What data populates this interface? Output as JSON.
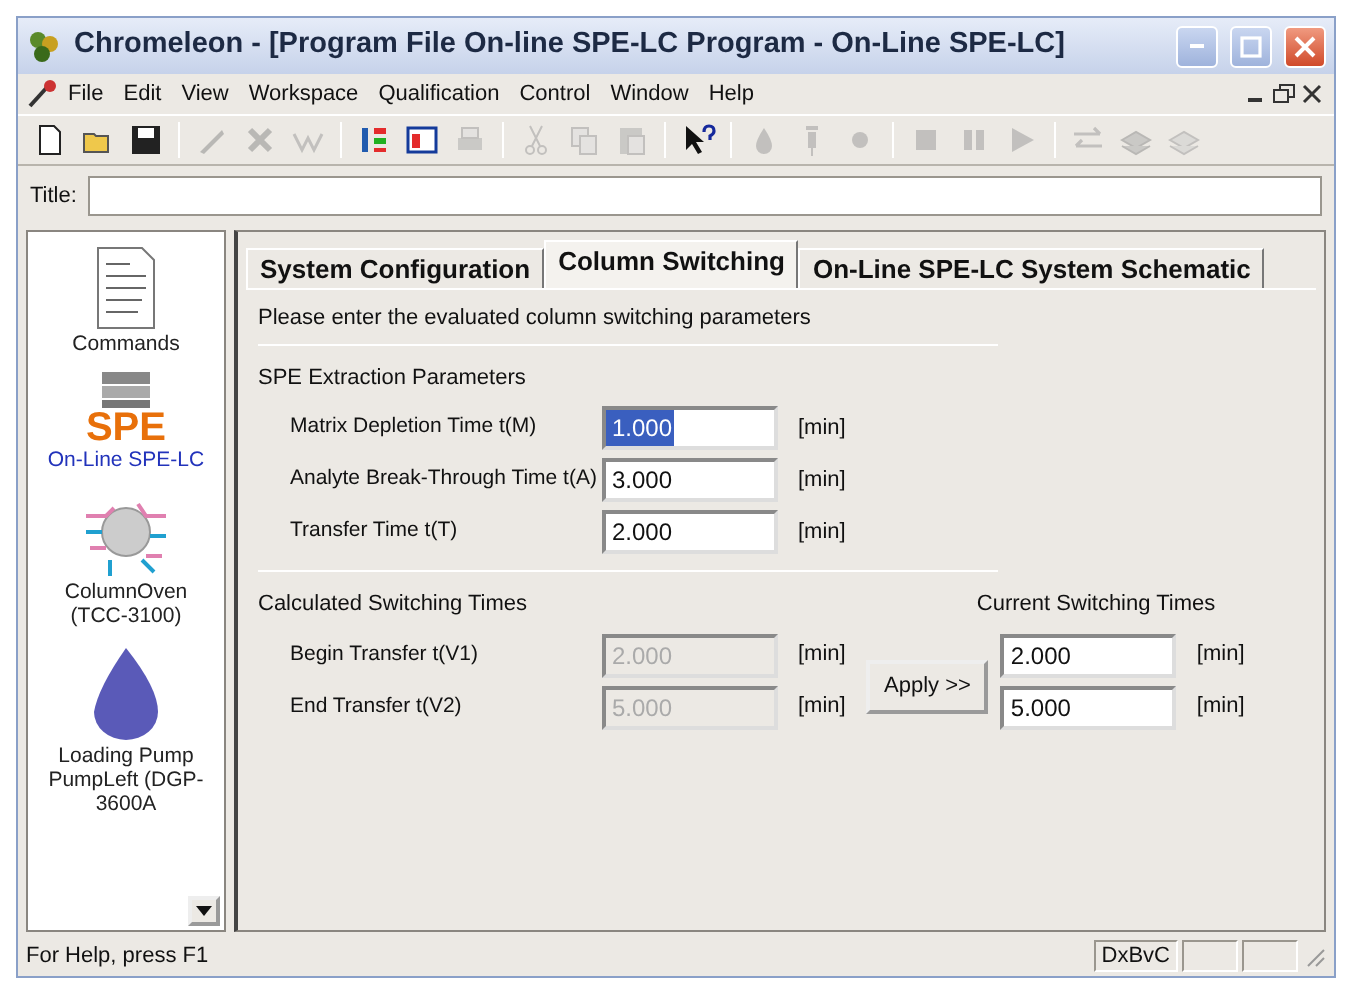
{
  "window": {
    "title": "Chromeleon - [Program File On-line SPE-LC Program - On-Line SPE-LC]"
  },
  "menu": [
    "File",
    "Edit",
    "View",
    "Workspace",
    "Qualification",
    "Control",
    "Window",
    "Help"
  ],
  "toolbar": [
    [
      {
        "disabled": false
      },
      {
        "disabled": false
      },
      {
        "disabled": false
      }
    ],
    [
      {
        "disabled": true
      },
      {
        "disabled": true
      },
      {
        "disabled": true
      }
    ],
    [
      {
        "disabled": false
      },
      {
        "disabled": false
      },
      {
        "disabled": true
      }
    ],
    [
      {
        "disabled": true
      },
      {
        "disabled": true
      },
      {
        "disabled": true
      }
    ],
    [
      {
        "disabled": false
      }
    ],
    [
      {
        "disabled": true
      },
      {
        "disabled": true
      },
      {
        "disabled": true
      }
    ],
    [
      {
        "disabled": true
      },
      {
        "disabled": true
      },
      {
        "disabled": true
      }
    ],
    [
      {
        "disabled": true
      },
      {
        "disabled": true
      },
      {
        "disabled": true
      }
    ]
  ],
  "title_field": {
    "label": "Title:"
  },
  "sidebar": {
    "items": [
      {
        "kind": "commands",
        "label": "Commands",
        "selected": false
      },
      {
        "kind": "spe",
        "label": "On-Line SPE-LC",
        "selected": true,
        "badge": "SPE"
      },
      {
        "kind": "oven",
        "label": "ColumnOven (TCC-3100)",
        "selected": false
      },
      {
        "kind": "pump",
        "label": "Loading Pump PumpLeft (DGP-3600A",
        "selected": false
      }
    ]
  },
  "tabs": [
    {
      "label": "System Configuration",
      "selected": false
    },
    {
      "label": "Column Switching",
      "selected": true
    },
    {
      "label": "On-Line SPE-LC System Schematic",
      "selected": false
    }
  ],
  "instruction": "Please enter the evaluated column switching parameters",
  "spe_section": {
    "title": "SPE Extraction Parameters",
    "fields": [
      {
        "label": "Matrix Depletion Time t(M)",
        "value": "1.000",
        "unit": "[min]",
        "disabled": false,
        "selected": true
      },
      {
        "label": "Analyte Break-Through Time t(A)",
        "value": "3.000",
        "unit": "[min]",
        "disabled": false,
        "selected": false
      },
      {
        "label": "Transfer Time t(T)",
        "value": "2.000",
        "unit": "[min]",
        "disabled": false,
        "selected": false
      }
    ]
  },
  "calculated": {
    "title": "Calculated Switching Times",
    "fields": [
      {
        "label": "Begin Transfer t(V1)",
        "value": "2.000",
        "unit": "[min]",
        "disabled": true
      },
      {
        "label": "End Transfer t(V2)",
        "value": "5.000",
        "unit": "[min]",
        "disabled": true
      }
    ]
  },
  "apply_button": "Apply >>",
  "current": {
    "title": "Current Switching Times",
    "fields": [
      {
        "value": "2.000",
        "unit": "[min]",
        "disabled": false
      },
      {
        "value": "5.000",
        "unit": "[min]",
        "disabled": false
      }
    ]
  },
  "status_bar": {
    "help": "For Help, press F1",
    "panels": [
      "DxBvC"
    ]
  }
}
